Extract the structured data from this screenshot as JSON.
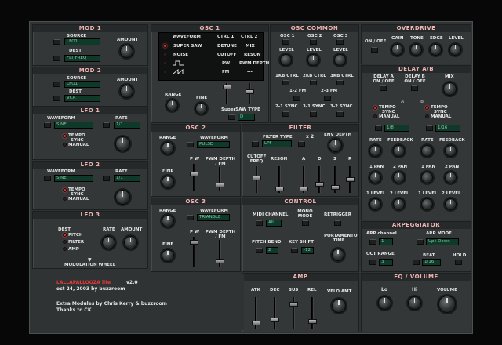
{
  "mod1": {
    "title": "MOD 1",
    "source": "SOURCE",
    "source_val": "LFO1",
    "dest": "DEST",
    "dest_val": "FLT FREQ",
    "amount": "AMOUNT"
  },
  "mod2": {
    "title": "MOD 2",
    "source": "SOURCE",
    "source_val": "LFO1",
    "dest": "DEST",
    "dest_val": "VCA",
    "amount": "AMOUNT"
  },
  "lfo1": {
    "title": "LFO 1",
    "waveform": "WAVEFORM",
    "wave_val": "SINE",
    "rate": "RATE",
    "rate_val": "1/1",
    "tempo": "TEMPO",
    "sync": "SYNC",
    "manual": "MANUAL"
  },
  "lfo2": {
    "title": "LFO 2",
    "waveform": "WAVEFORM",
    "wave_val": "SINE",
    "rate": "RATE",
    "rate_val": "1/1",
    "tempo": "TEMPO",
    "sync": "SYNC",
    "manual": "MANUAL"
  },
  "lfo3": {
    "title": "LFO 3",
    "dest": "DEST",
    "pitch": "PITCH",
    "filter": "FILTER",
    "amp": "AMP",
    "rate": "RATE",
    "amount": "AMOUNT",
    "modwheel": "MODULATION WHEEL"
  },
  "osc1": {
    "title": "OSC 1",
    "waveform": "WAVEFORM",
    "ctrl1": "CTRL 1",
    "ctrl2": "CTRL 2",
    "rows": [
      {
        "wave": "SUPER SAW",
        "c1": "DETUNE",
        "c2": "MIX"
      },
      {
        "wave": "NOISE",
        "c1": "CUTOFF",
        "c2": "RESON"
      },
      {
        "wave": "",
        "c1": "PW",
        "c2": "PWM DEPTH"
      },
      {
        "wave": "",
        "c1": "FM",
        "c2": "---"
      }
    ],
    "range": "RANGE",
    "fine": "FINE",
    "supersaw": "SuperSAW TYPE",
    "supersaw_val": "D"
  },
  "osc2": {
    "title": "OSC 2",
    "range": "RANGE",
    "waveform": "WAVEFORM",
    "wave_val": "PULSE",
    "fine": "FINE",
    "pw": "P W",
    "pwm": "PWM DEPTH / FM"
  },
  "osc3": {
    "title": "OSC 3",
    "range": "RANGE",
    "waveform": "WAVEFORM",
    "wave_val": "TRIANGLE",
    "fine": "FINE",
    "pw": "P W",
    "pwm": "PWM DEPTH / FM"
  },
  "osccommon": {
    "title": "OSC COMMON",
    "o1": "OSC 1",
    "o2": "OSC 2",
    "o3": "OSC 3",
    "level": "LEVEL",
    "kb1": "1KB CTRL",
    "kb2": "2KB CTRL",
    "kb3": "3KB CTRL",
    "fm12": "1-2 FM",
    "fm23": "2-3 FM",
    "s21": "2-1 SYNC",
    "s31": "3-1 SYNC",
    "s32": "3-2 SYNC"
  },
  "filter": {
    "title": "FILTER",
    "type": "FILTER TYPE",
    "type_val": "LPF",
    "x2": "x 2",
    "env": "ENV DEPTH",
    "cutoff": "CUTOFF FREQ",
    "reson": "RESON",
    "a": "A",
    "d": "D",
    "s": "S",
    "r": "R"
  },
  "control": {
    "title": "CONTROL",
    "midi": "MIDI CHANNEL",
    "midi_val": "All",
    "mono": "MONO MODE",
    "retrig": "RETRIGGER",
    "bend": "PITCH BEND",
    "bend_val": "2",
    "keyshift": "KEY SHIFT",
    "keyshift_val": "-12",
    "porta": "PORTAMENTO TIME"
  },
  "amp": {
    "title": "AMP",
    "atk": "ATK",
    "dec": "DEC",
    "sus": "SUS",
    "rel": "REL",
    "velo": "VELO AMT"
  },
  "overdrive": {
    "title": "OVERDRIVE",
    "onoff": "ON / OFF",
    "gain": "GAIN",
    "tone": "TONE",
    "edge": "EDGE",
    "level": "LEVEL"
  },
  "delay": {
    "title": "DELAY A/B",
    "a_onoff": "DELAY A ON / OFF",
    "b_onoff": "DELAY B ON / OFF",
    "mix": "MIX",
    "a": "A",
    "b": "B",
    "tempo": "TEMPO",
    "sync": "SYNC",
    "manual": "MANUAL",
    "a_val": "1/8",
    "b_val": "1/16",
    "rate": "RATE",
    "feedback": "FEEDBACK",
    "pan1": "1 PAN",
    "pan2": "2 PAN",
    "lev1": "1 LEVEL",
    "lev2": "2 LEVEL"
  },
  "arp": {
    "title": "ARPEGGIATOR",
    "channel": "ARP channel",
    "channel_val": "1",
    "mode": "ARP MODE",
    "mode_val": "Up+Down",
    "oct": "OCT RANGE",
    "oct_val": "3",
    "beat": "BEAT",
    "beat_val": "1/16",
    "hold": "HOLD"
  },
  "eq": {
    "title": "EQ / VOLUME",
    "lo": "Lo",
    "hi": "Hi",
    "volume": "VOLUME"
  },
  "info": {
    "name": "LALLAPALLOOZA lite",
    "version": "v2.0",
    "date": "oct 24, 2003  by buzzroom",
    "extra": "Extra Modules by  Chris Kerry & buzzroom",
    "thanks": "Thanks to CK"
  }
}
